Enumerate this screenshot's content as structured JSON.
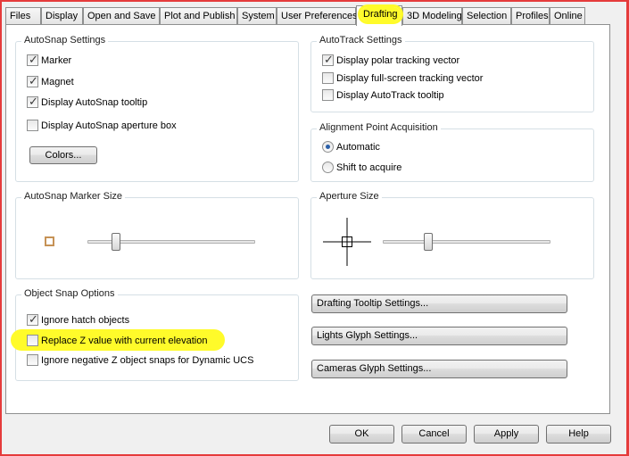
{
  "tabs": [
    "Files",
    "Display",
    "Open and Save",
    "Plot and Publish",
    "System",
    "User Preferences",
    "Drafting",
    "3D Modeling",
    "Selection",
    "Profiles",
    "Online"
  ],
  "active_tab": "Drafting",
  "autosnap": {
    "title": "AutoSnap Settings",
    "marker": {
      "label": "Marker",
      "checked": true
    },
    "magnet": {
      "label": "Magnet",
      "checked": true
    },
    "tooltip": {
      "label": "Display AutoSnap tooltip",
      "checked": true
    },
    "aperture": {
      "label": "Display AutoSnap aperture box",
      "checked": false
    },
    "colors_button": "Colors..."
  },
  "autotrack": {
    "title": "AutoTrack Settings",
    "polar": {
      "label": "Display polar tracking vector",
      "checked": true
    },
    "fullscreen": {
      "label": "Display full-screen tracking vector",
      "checked": false
    },
    "tooltip": {
      "label": "Display AutoTrack tooltip",
      "checked": false
    }
  },
  "alignment": {
    "title": "Alignment Point Acquisition",
    "automatic": {
      "label": "Automatic",
      "selected": true
    },
    "shift": {
      "label": "Shift to acquire",
      "selected": false
    }
  },
  "marker_size": {
    "title": "AutoSnap Marker Size",
    "value": 0.17
  },
  "aperture_size": {
    "title": "Aperture Size",
    "value": 0.27
  },
  "osnap": {
    "title": "Object Snap Options",
    "ignore_hatch": {
      "label": "Ignore hatch objects",
      "checked": true
    },
    "replace_z": {
      "label": "Replace Z value with current elevation",
      "checked": false
    },
    "ignore_negative_z": {
      "label": "Ignore negative Z object snaps for Dynamic UCS",
      "checked": false
    }
  },
  "side_buttons": {
    "tooltip": "Drafting Tooltip Settings...",
    "lights": "Lights Glyph Settings...",
    "cameras": "Cameras Glyph Settings..."
  },
  "footer": {
    "ok": "OK",
    "cancel": "Cancel",
    "apply": "Apply",
    "help": "Help"
  },
  "colors": {
    "highlight": "#fffb2a",
    "frame": "#e53b3b",
    "marker": "#c69256"
  }
}
